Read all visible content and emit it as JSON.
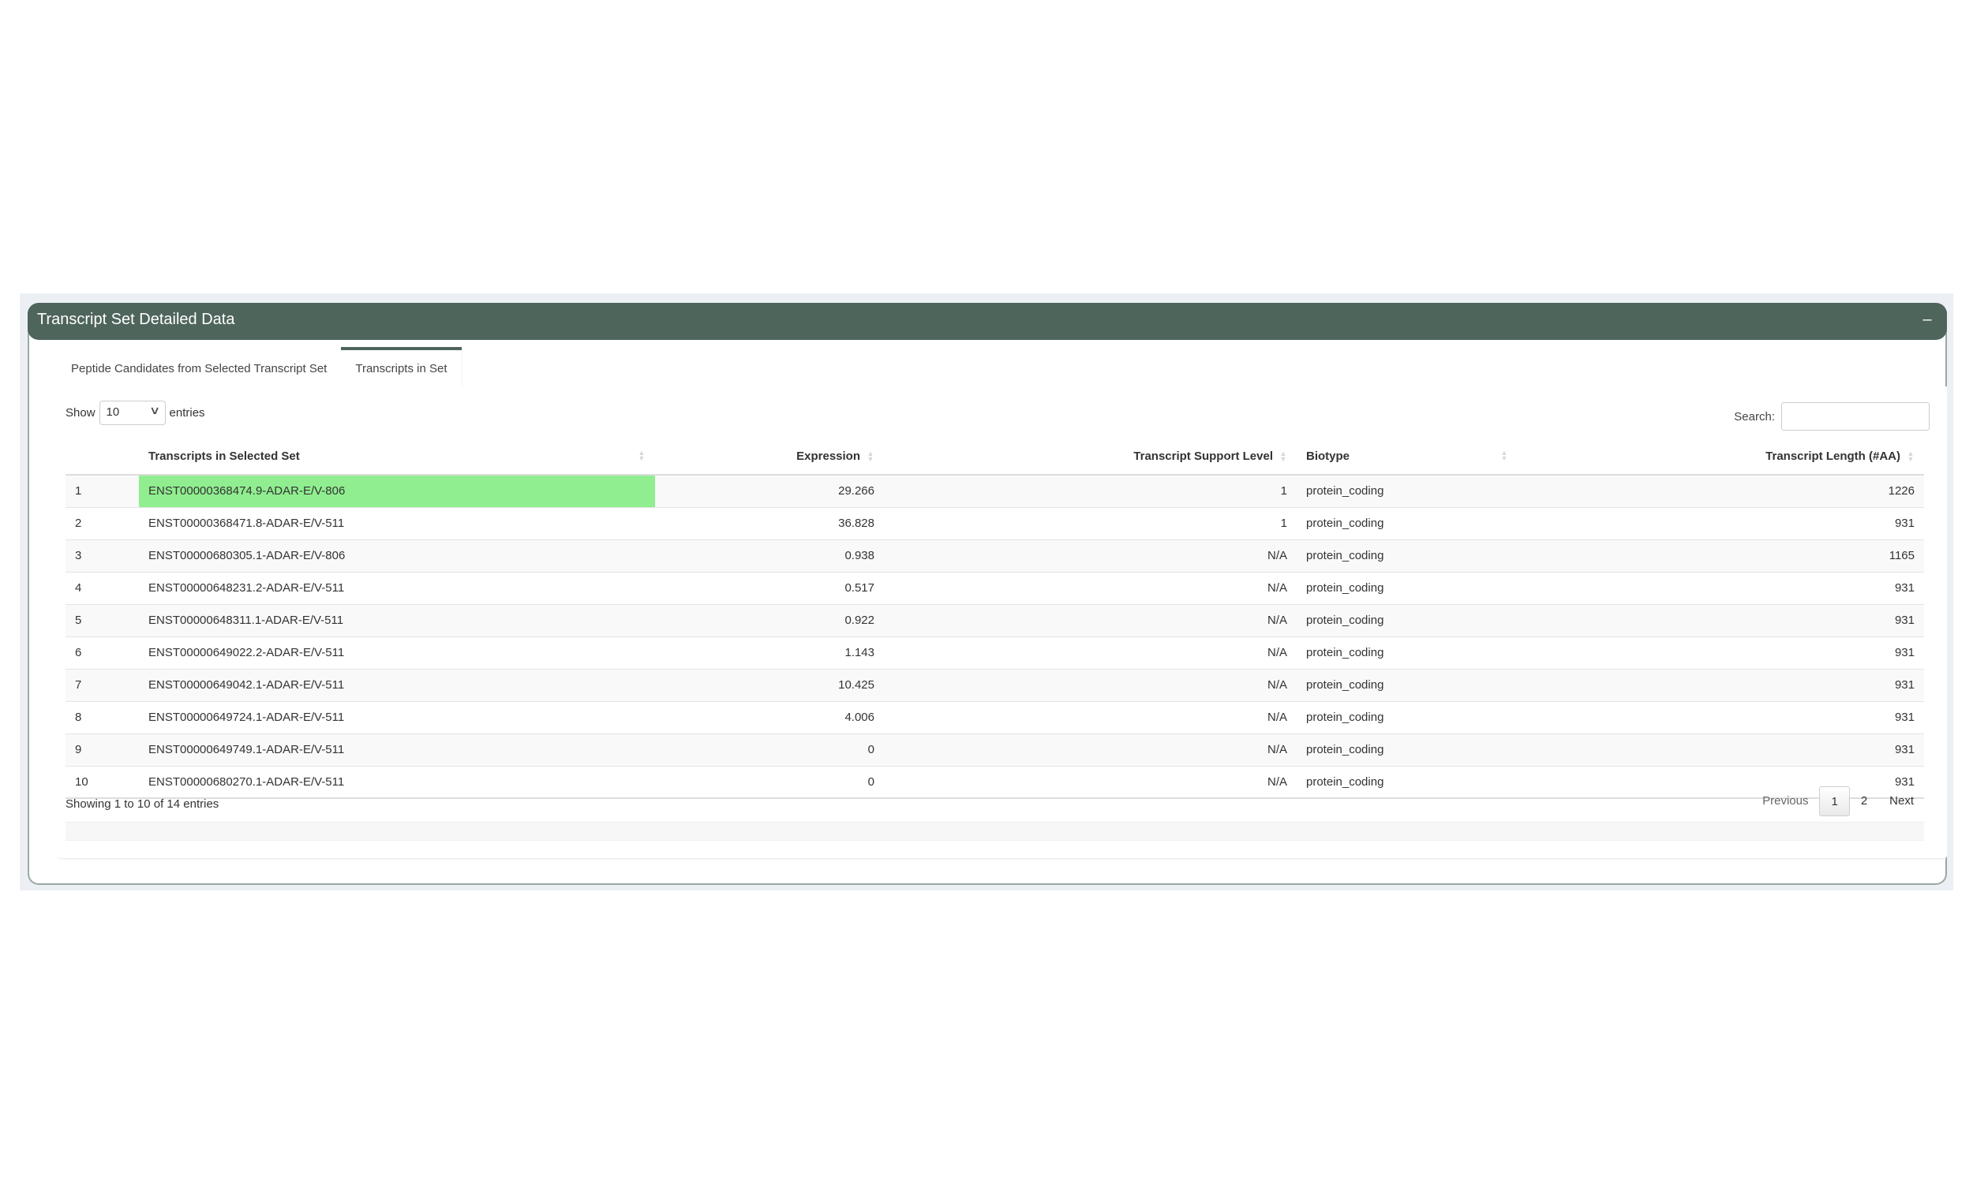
{
  "panel": {
    "title": "Transcript Set Detailed Data",
    "collapse_icon": "minus-icon",
    "collapse_glyph": "–"
  },
  "tabs": [
    {
      "label": "Peptide Candidates from Selected Transcript Set",
      "active": false
    },
    {
      "label": "Transcripts in Set",
      "active": true
    }
  ],
  "length_control": {
    "prefix": "Show",
    "value": "10",
    "suffix": "entries",
    "chevron": "∨"
  },
  "search": {
    "label": "Search:",
    "value": "",
    "placeholder": ""
  },
  "table": {
    "columns": [
      {
        "label": "",
        "align": "left",
        "sortable": false
      },
      {
        "label": "Transcripts in Selected Set",
        "align": "left",
        "sortable": true
      },
      {
        "label": "Expression",
        "align": "right",
        "sortable": true
      },
      {
        "label": "Transcript Support Level",
        "align": "right",
        "sortable": true
      },
      {
        "label": "Biotype",
        "align": "left",
        "sortable": true
      },
      {
        "label": "Transcript Length (#AA)",
        "align": "right",
        "sortable": true
      }
    ],
    "highlight_color": "#90ee90",
    "rows": [
      {
        "index": "1",
        "transcript": "ENST00000368474.9-ADAR-E/V-806",
        "expression": "29.266",
        "tsl": "1",
        "biotype": "protein_coding",
        "length": "1226",
        "highlighted": true
      },
      {
        "index": "2",
        "transcript": "ENST00000368471.8-ADAR-E/V-511",
        "expression": "36.828",
        "tsl": "1",
        "biotype": "protein_coding",
        "length": "931",
        "highlighted": false
      },
      {
        "index": "3",
        "transcript": "ENST00000680305.1-ADAR-E/V-806",
        "expression": "0.938",
        "tsl": "N/A",
        "biotype": "protein_coding",
        "length": "1165",
        "highlighted": false
      },
      {
        "index": "4",
        "transcript": "ENST00000648231.2-ADAR-E/V-511",
        "expression": "0.517",
        "tsl": "N/A",
        "biotype": "protein_coding",
        "length": "931",
        "highlighted": false
      },
      {
        "index": "5",
        "transcript": "ENST00000648311.1-ADAR-E/V-511",
        "expression": "0.922",
        "tsl": "N/A",
        "biotype": "protein_coding",
        "length": "931",
        "highlighted": false
      },
      {
        "index": "6",
        "transcript": "ENST00000649022.2-ADAR-E/V-511",
        "expression": "1.143",
        "tsl": "N/A",
        "biotype": "protein_coding",
        "length": "931",
        "highlighted": false
      },
      {
        "index": "7",
        "transcript": "ENST00000649042.1-ADAR-E/V-511",
        "expression": "10.425",
        "tsl": "N/A",
        "biotype": "protein_coding",
        "length": "931",
        "highlighted": false
      },
      {
        "index": "8",
        "transcript": "ENST00000649724.1-ADAR-E/V-511",
        "expression": "4.006",
        "tsl": "N/A",
        "biotype": "protein_coding",
        "length": "931",
        "highlighted": false
      },
      {
        "index": "9",
        "transcript": "ENST00000649749.1-ADAR-E/V-511",
        "expression": "0",
        "tsl": "N/A",
        "biotype": "protein_coding",
        "length": "931",
        "highlighted": false
      },
      {
        "index": "10",
        "transcript": "ENST00000680270.1-ADAR-E/V-511",
        "expression": "0",
        "tsl": "N/A",
        "biotype": "protein_coding",
        "length": "931",
        "highlighted": false
      }
    ]
  },
  "footer": {
    "info": "Showing 1 to 10 of 14 entries",
    "pagination": {
      "previous": "Previous",
      "pages": [
        "1",
        "2"
      ],
      "current": "1",
      "next": "Next"
    }
  }
}
